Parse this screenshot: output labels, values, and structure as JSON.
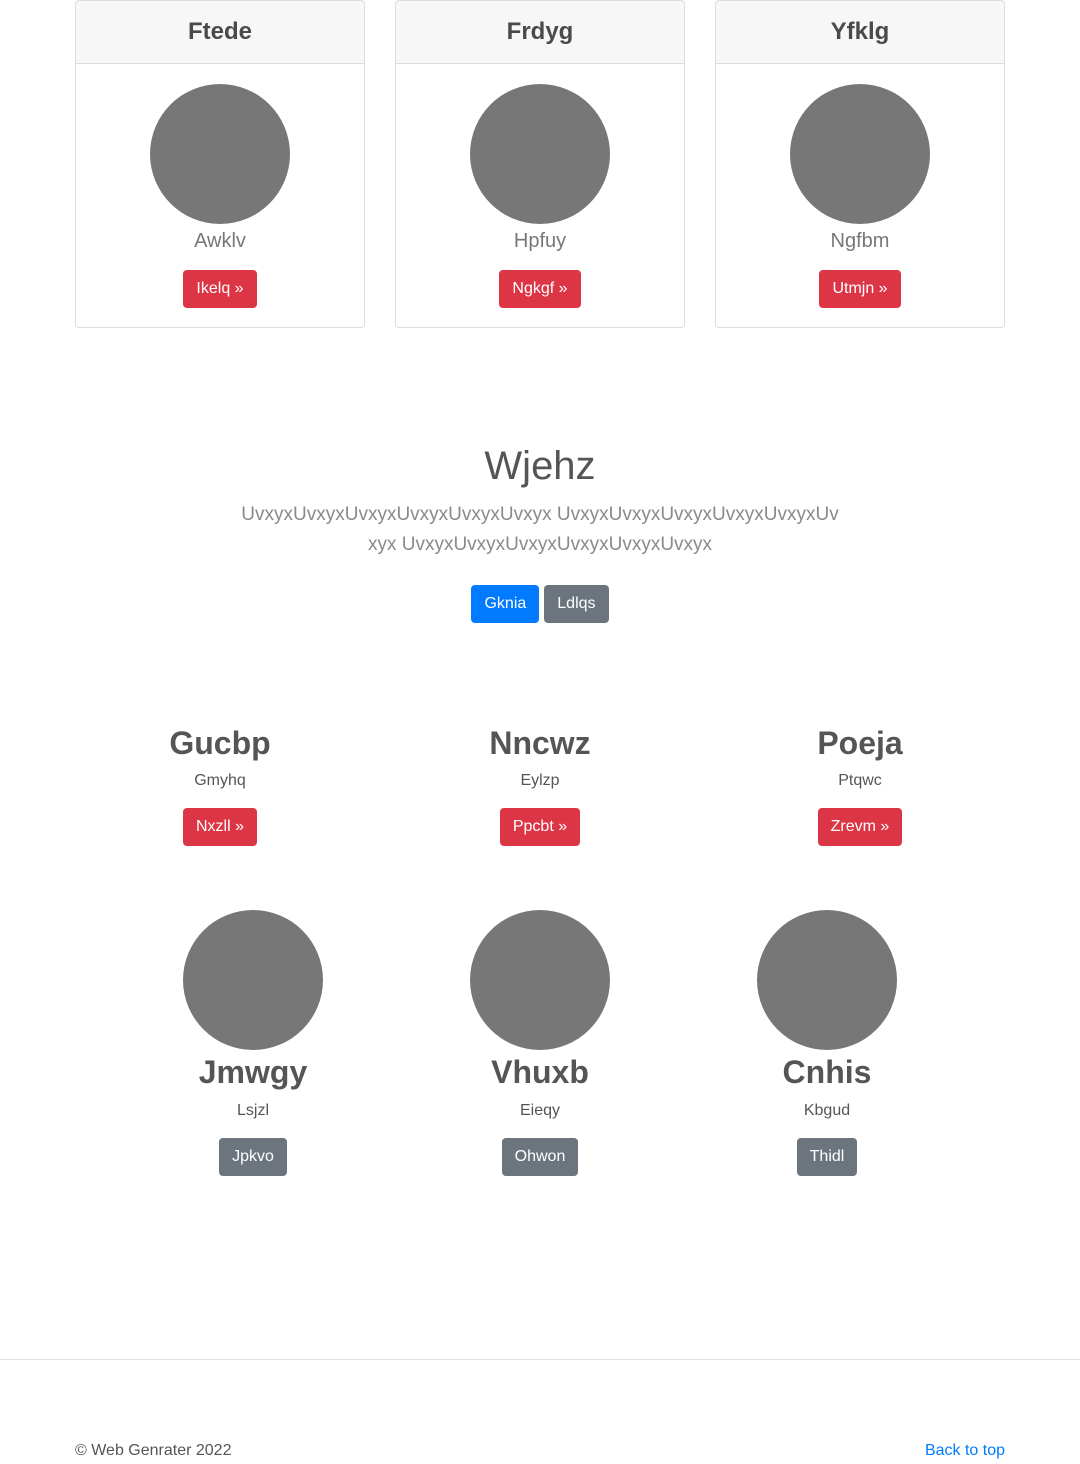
{
  "cards": [
    {
      "title": "Ftede",
      "subtitle": "Awklv",
      "button": "Ikelq »"
    },
    {
      "title": "Frdyg",
      "subtitle": "Hpfuy",
      "button": "Ngkgf »"
    },
    {
      "title": "Yfklg",
      "subtitle": "Ngfbm",
      "button": "Utmjn »"
    }
  ],
  "jumbotron": {
    "title": "Wjehz",
    "lead": "UvxyxUvxyxUvxyxUvxyxUvxyxUvxyx UvxyxUvxyxUvxyxUvxyxUvxyxUvxyx UvxyxUvxyxUvxyxUvxyxUvxyxUvxyx",
    "primary_button": "Gknia",
    "secondary_button": "Ldlqs"
  },
  "features": [
    {
      "title": "Gucbp",
      "subtitle": "Gmyhq",
      "button": "Nxzll »"
    },
    {
      "title": "Nncwz",
      "subtitle": "Eylzp",
      "button": "Ppcbt »"
    },
    {
      "title": "Poeja",
      "subtitle": "Ptqwc",
      "button": "Zrevm »"
    }
  ],
  "profiles": [
    {
      "name": "Jmwgy",
      "subtitle": "Lsjzl",
      "button": "Jpkvo"
    },
    {
      "name": "Vhuxb",
      "subtitle": "Eieqy",
      "button": "Ohwon"
    },
    {
      "name": "Cnhis",
      "subtitle": "Kbgud",
      "button": "Thidl"
    }
  ],
  "footer": {
    "copyright": "© Web Genrater 2022",
    "back_to_top": "Back to top"
  },
  "colors": {
    "danger": "#dc3545",
    "primary": "#007bff",
    "secondary": "#6c757d",
    "placeholder": "#777777"
  }
}
